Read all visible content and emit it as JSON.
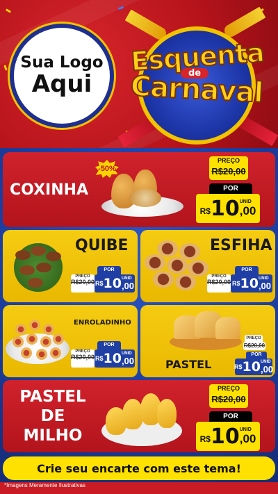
{
  "header": {
    "logo_line1": "Sua Logo",
    "logo_line2": "Aqui",
    "title_line1": "Esquenta",
    "title_de": "de",
    "title_line2": "Carnaval"
  },
  "products": {
    "coxinha": {
      "name": "COXINHA",
      "discount": "-50%",
      "preco_label": "PREÇO",
      "old_price": "R$20,00",
      "por_label": "POR",
      "currency": "R$",
      "price_int": "10",
      "price_dec": ",00",
      "unit": "UNID"
    },
    "quibe": {
      "name": "QUIBE",
      "preco_label": "PREÇO",
      "old_price": "R$20,00",
      "por_label": "POR",
      "currency": "R$",
      "price_int": "10",
      "price_dec": ",00",
      "unit": "UNID"
    },
    "esfiha": {
      "name": "ESFIHA",
      "preco_label": "PREÇO",
      "old_price": "R$20,00",
      "por_label": "POR",
      "currency": "R$",
      "price_int": "10",
      "price_dec": ",00",
      "unit": "UNID"
    },
    "enroladinho": {
      "name": "ENROLADINHO",
      "preco_label": "PREÇO",
      "old_price": "R$20,00",
      "por_label": "POR",
      "currency": "R$",
      "price_int": "10",
      "price_dec": ",00",
      "unit": "UNID"
    },
    "pastel": {
      "name": "PASTEL",
      "preco_label": "PREÇO",
      "old_price": "R$20,00",
      "por_label": "POR",
      "currency": "R$",
      "price_int": "10",
      "price_dec": ",00",
      "unit": "UNID"
    },
    "pastel_milho": {
      "name_line1": "PASTEL",
      "name_line2": "DE",
      "name_line3": "MILHO",
      "preco_label": "PREÇO",
      "old_price": "R$20,00",
      "por_label": "POR",
      "currency": "R$",
      "price_int": "10",
      "price_dec": ",00",
      "unit": "UNID"
    }
  },
  "footer": {
    "cta": "Crie seu encarte com este tema!",
    "disclaimer": "*Imagens Meramente Ilustrativas"
  },
  "colors": {
    "red": "#c81b23",
    "yellow": "#f5cc12",
    "blue": "#1f3fa4",
    "price_yellow": "#ffe100"
  }
}
